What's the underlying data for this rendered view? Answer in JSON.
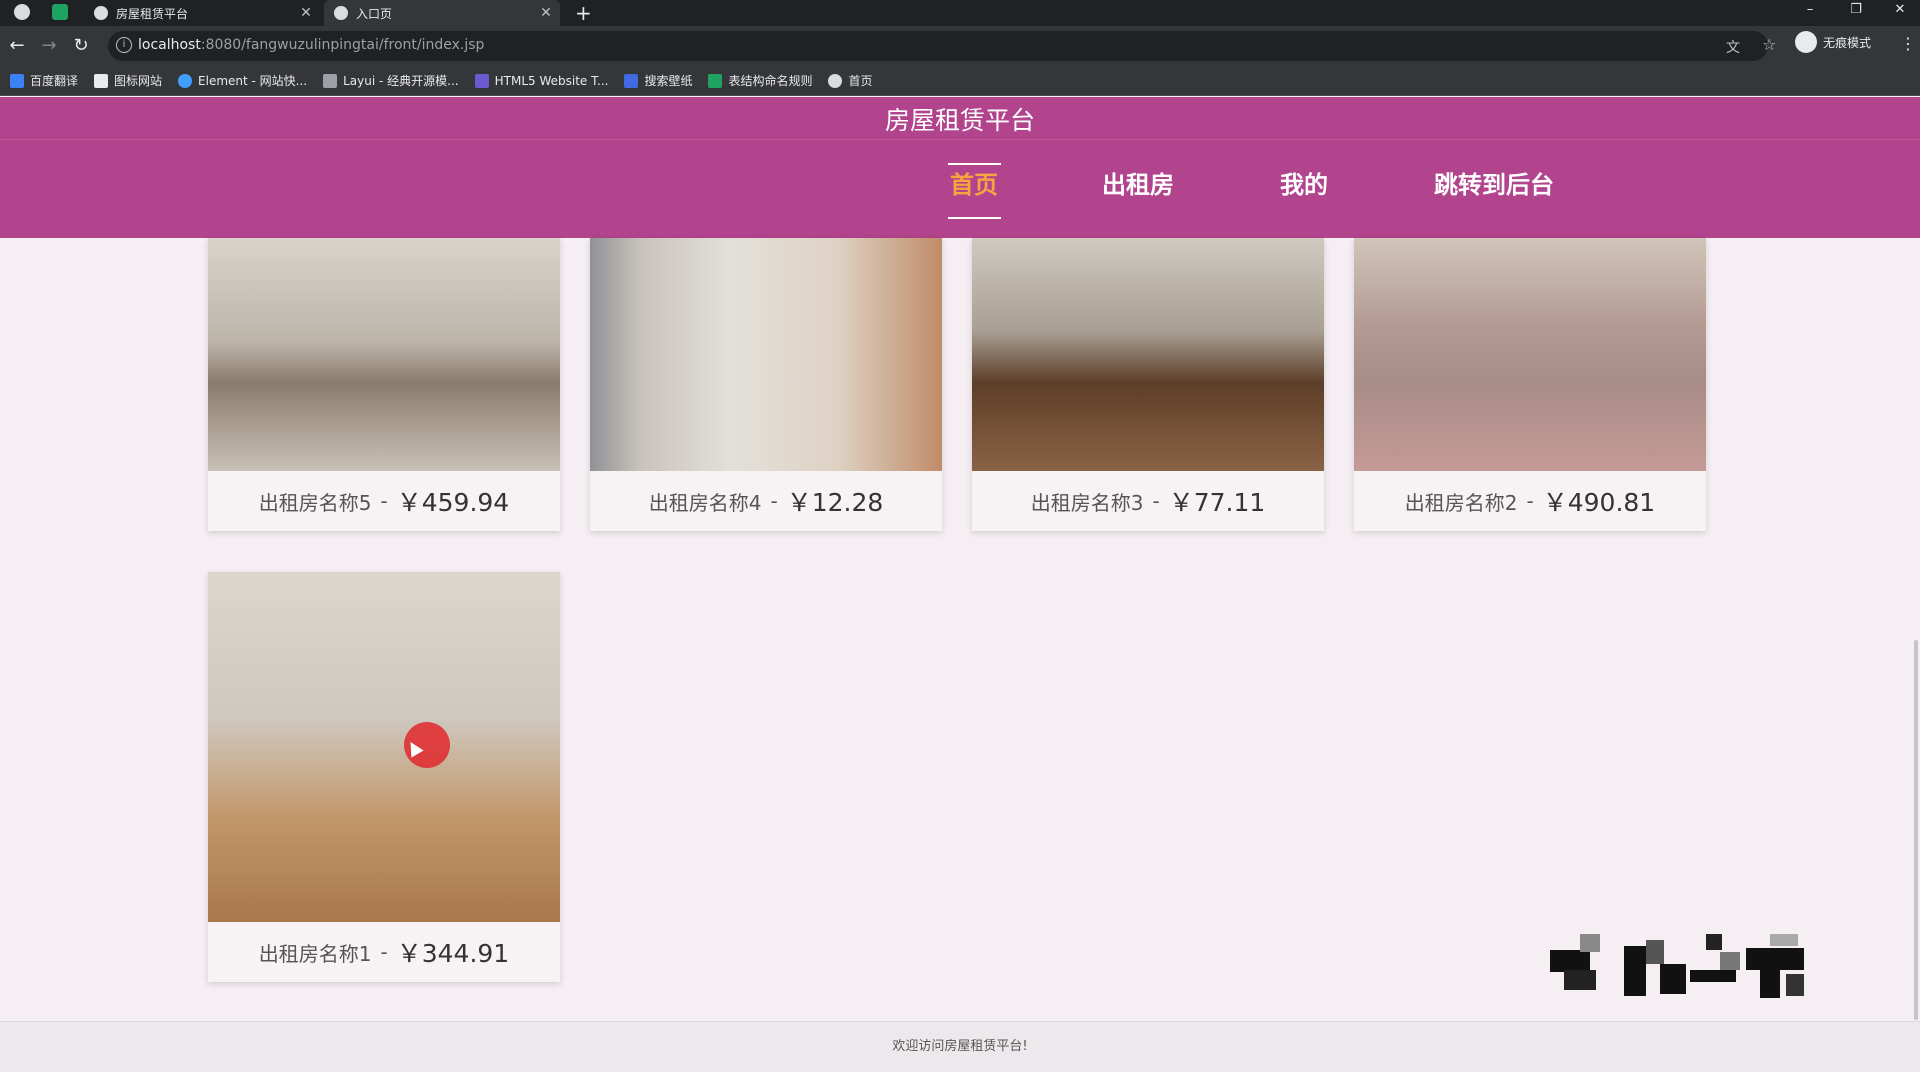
{
  "browser": {
    "tabs": [
      {
        "title": "房屋租赁平台"
      },
      {
        "title": "入口页"
      }
    ],
    "new_tab": "+",
    "window_controls": {
      "minimize": "–",
      "restore": "❐",
      "close": "✕"
    },
    "nav_icons": {
      "back": "←",
      "forward": "→",
      "reload": "↻"
    },
    "address": {
      "host": "localhost",
      "path": ":8080/fangwuzulinpingtai/front/index.jsp"
    },
    "profile_label": "无痕模式",
    "menu": "⋮",
    "bookmarks": [
      {
        "label": "百度翻译",
        "icon": "baidu-translate-icon",
        "color": "#3b82f6"
      },
      {
        "label": "图标网站",
        "icon": "flag-icon",
        "color": "#e8eaed"
      },
      {
        "label": "Element - 网站快...",
        "icon": "element-icon",
        "color": "#409eff"
      },
      {
        "label": "Layui - 经典开源模...",
        "icon": "layui-icon",
        "color": "#9aa0a6"
      },
      {
        "label": "HTML5 Website T...",
        "icon": "html5-template-icon",
        "color": "#6a5acd"
      },
      {
        "label": "搜索壁纸",
        "icon": "wallpaper-search-icon",
        "color": "#4169e1"
      },
      {
        "label": "表结构命名规则",
        "icon": "sheet-icon",
        "color": "#1ea362"
      },
      {
        "label": "首页",
        "icon": "globe-icon",
        "color": "#dadce0"
      }
    ]
  },
  "site": {
    "title": "房屋租赁平台",
    "nav": [
      {
        "label": "首页",
        "active": true
      },
      {
        "label": "出租房",
        "active": false
      },
      {
        "label": "我的",
        "active": false
      },
      {
        "label": "跳转到后台",
        "active": false
      }
    ],
    "listings": [
      {
        "name": "出租房名称5",
        "separator": "-",
        "price": "￥459.94"
      },
      {
        "name": "出租房名称4",
        "separator": "-",
        "price": "￥12.28"
      },
      {
        "name": "出租房名称3",
        "separator": "-",
        "price": "￥77.11"
      },
      {
        "name": "出租房名称2",
        "separator": "-",
        "price": "￥490.81"
      },
      {
        "name": "出租房名称1",
        "separator": "-",
        "price": "￥344.91"
      }
    ],
    "footer": "欢迎访问房屋租赁平台!",
    "colors": {
      "header": "#b2438d",
      "active_nav": "#f7a440",
      "page_bg": "#f5eff3"
    }
  }
}
